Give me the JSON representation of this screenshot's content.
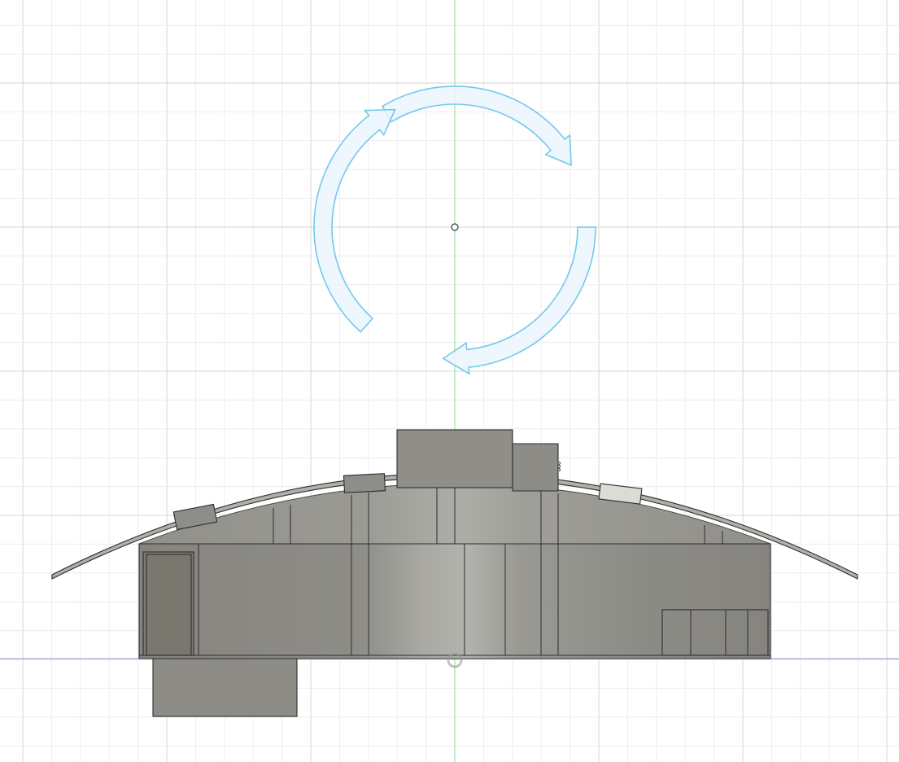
{
  "app": {
    "view": "orthographic-front",
    "tool": "rotate"
  },
  "colors": {
    "background": "#ffffff",
    "grid_minor": "#ececec",
    "grid_major": "#d6d6d6",
    "vertical_axis": "#7ee07e",
    "horizontal_axis": "#9c9ce6",
    "gizmo_fill": "#eaf6fd",
    "gizmo_stroke": "#74c8ec",
    "body_fill": "#8f8e88",
    "body_dark": "#7a7872",
    "body_light": "#a3a29c",
    "plate_fill": "#dcdcd6"
  },
  "gizmo": {
    "name": "rotate-gizmo",
    "handles": [
      "rotate-arrow-top",
      "rotate-arrow-right",
      "rotate-arrow-bottom",
      "rotate-arrow-left"
    ],
    "pivot_icon": "circle-pivot-icon"
  },
  "model": {
    "name": "curved-roof-building",
    "parts": [
      "roof-shell",
      "main-body",
      "rooftop-block-large",
      "rooftop-block-small",
      "roof-vent-left",
      "roof-vent-center",
      "roof-vent-right",
      "door-panel",
      "underside-block",
      "lower-right-panels"
    ]
  }
}
